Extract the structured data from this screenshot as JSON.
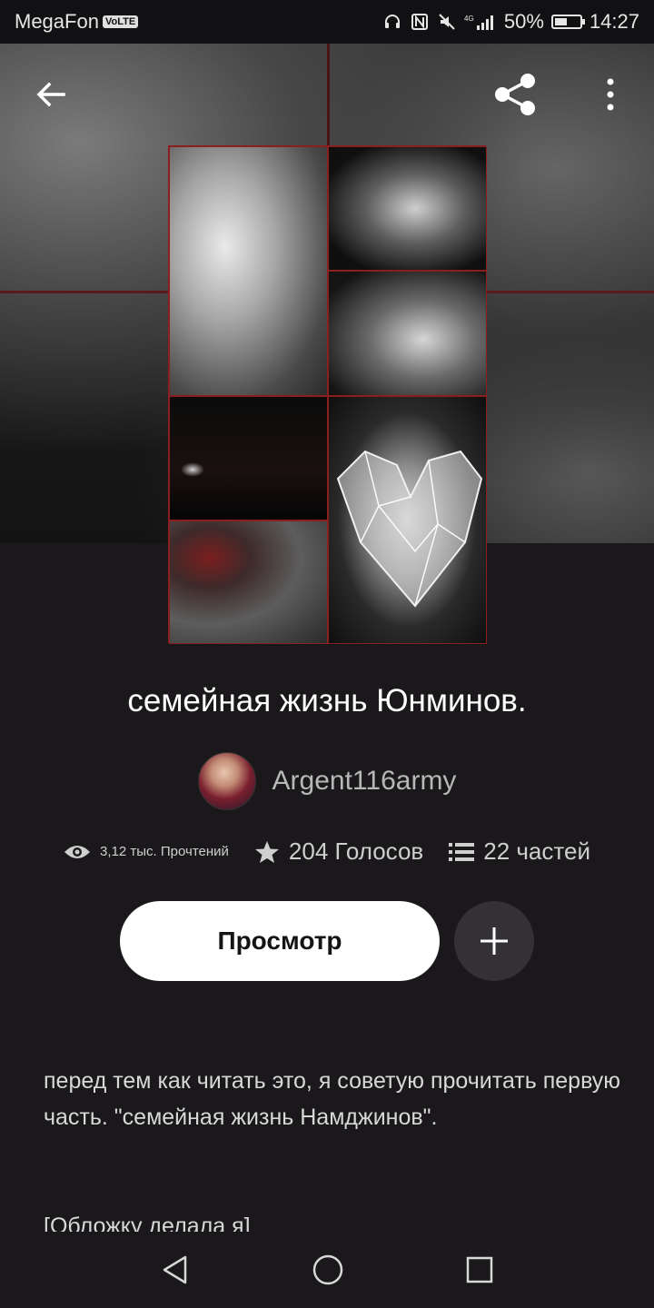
{
  "status_bar": {
    "carrier": "MegaFon",
    "volte": "VoLTE",
    "network": "4G",
    "battery_percent": "50%",
    "battery_level": 0.5,
    "time": "14:27",
    "icons": [
      "headphones-icon",
      "nfc-icon",
      "mute-icon",
      "signal-icon",
      "battery-icon"
    ]
  },
  "top_bar": {
    "icons": [
      "back-arrow-icon",
      "share-icon",
      "more-vertical-icon"
    ]
  },
  "story": {
    "title": "семейная жизнь Юнминов.",
    "author": "Argent116army",
    "stats": {
      "reads": "3,12 тыс. Прочтений",
      "votes": "204 Голосов",
      "parts": "22 частей"
    },
    "view_button": "Просмотр",
    "description": [
      "перед тем как читать это, я советую прочитать первую часть. \"семейная жизнь Намджинов\".",
      "[Обложку делала я]"
    ]
  },
  "nav_bar": {
    "icons": [
      "back-triangle-icon",
      "home-circle-icon",
      "recents-square-icon"
    ]
  },
  "colors": {
    "background": "#1a181b",
    "button_bg": "#ffffff",
    "add_button_bg": "#333135",
    "cover_border": "#8b1f1f"
  }
}
